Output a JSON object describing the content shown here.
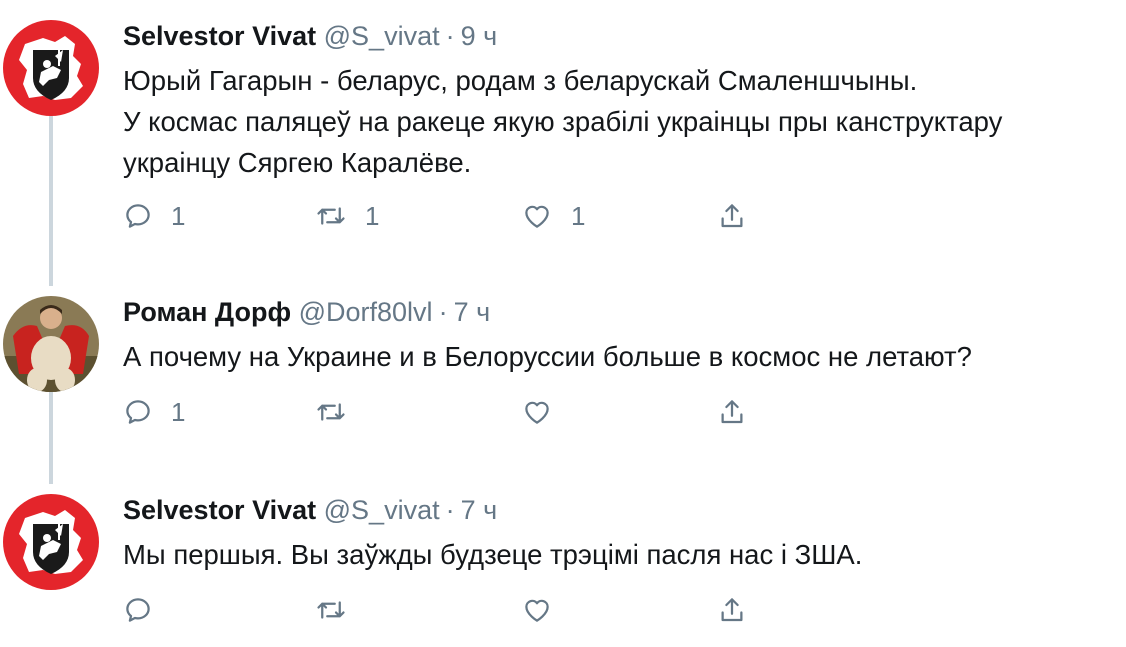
{
  "tweets": [
    {
      "name": "Selvestor Vivat",
      "handle": "@S_vivat",
      "separator": "·",
      "time": "9 ч",
      "text_lines": [
        "Юрый Гагарын - беларус, родам з беларускай Смаленшчыны.",
        "У космас паляцеў на ракеце якую зрабілі украінцы пры канструктару",
        "украінцу Сяргею Каралёве."
      ],
      "avatar": "selvestor-avatar",
      "reply_count": "1",
      "retweet_count": "1",
      "like_count": "1"
    },
    {
      "name": "Роман Дорф",
      "handle": "@Dorf80lvl",
      "separator": "·",
      "time": "7 ч",
      "text_lines": [
        "А почему на Украине и в Белоруссии больше в космос не летают?"
      ],
      "avatar": "roman-avatar",
      "reply_count": "1",
      "retweet_count": "",
      "like_count": ""
    },
    {
      "name": "Selvestor Vivat",
      "handle": "@S_vivat",
      "separator": "·",
      "time": "7 ч",
      "text_lines": [
        "Мы першыя. Вы заўжды будзеце трэцімі пасля нас і ЗША."
      ],
      "avatar": "selvestor-avatar",
      "reply_count": "",
      "retweet_count": "",
      "like_count": ""
    }
  ],
  "icons": {
    "reply": "reply-icon",
    "retweet": "retweet-icon",
    "like": "heart-icon",
    "share": "share-icon"
  },
  "colors": {
    "text": "#14171a",
    "secondary": "#657786",
    "thread_line": "#ccd6dd",
    "avatar_red": "#e4252b"
  }
}
